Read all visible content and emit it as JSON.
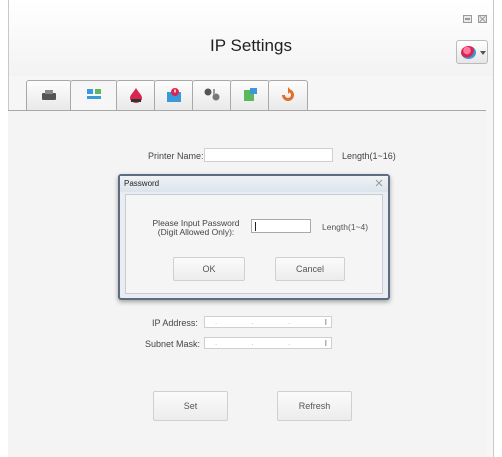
{
  "window": {
    "title": "IP Settings",
    "minimize_icon": "minimize-icon",
    "close_icon": "close-icon"
  },
  "tabs": [
    {
      "icon": "printer-icon",
      "active": false
    },
    {
      "icon": "network-icon",
      "active": true
    },
    {
      "icon": "ink-icon",
      "active": false
    },
    {
      "icon": "alert-icon",
      "active": false
    },
    {
      "icon": "tools-icon",
      "active": false
    },
    {
      "icon": "config-icon",
      "active": false
    },
    {
      "icon": "refresh-cycle-icon",
      "active": false
    }
  ],
  "form": {
    "printer_name_label": "Printer Name:",
    "printer_name_value": "",
    "printer_name_hint": "Length(1~16)",
    "ip_address_label": "IP Address:",
    "ip_address_value": ". . .",
    "subnet_mask_label": "Subnet Mask:",
    "subnet_mask_value": ". . .",
    "ibeam": "I",
    "set_label": "Set",
    "refresh_label": "Refresh"
  },
  "dialog": {
    "title": "Password",
    "prompt_line1": "Please Input Password",
    "prompt_line2": "(Digit Allowed Only):",
    "password_value": "",
    "hint": "Length(1~4)",
    "ok_label": "OK",
    "cancel_label": "Cancel"
  },
  "colors": {
    "dialog_border": "#5d6c82",
    "ink_red": "#d9264e",
    "accent_blue": "#3a9ad9"
  }
}
